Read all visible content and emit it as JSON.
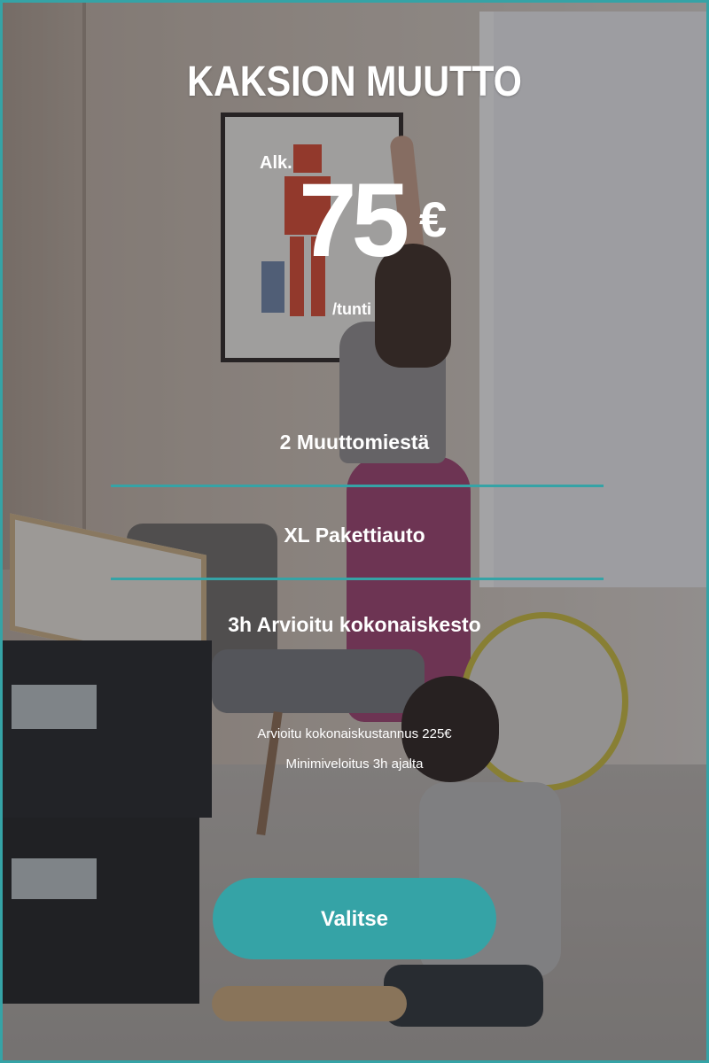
{
  "card": {
    "title": "KAKSION MUUTTO",
    "price": {
      "prefix": "Alk.",
      "amount": "75",
      "currency": "€",
      "unit": "/tunti"
    },
    "features": [
      "2 Muuttomiestä",
      "XL Pakettiauto",
      "3h Arvioitu kokonaiskesto"
    ],
    "notes": [
      "Arvioitu kokonaiskustannus 225€",
      "Minimiveloitus 3h ajalta"
    ],
    "button_label": "Valitse"
  },
  "colors": {
    "accent": "#35a3a6",
    "text": "#ffffff"
  }
}
